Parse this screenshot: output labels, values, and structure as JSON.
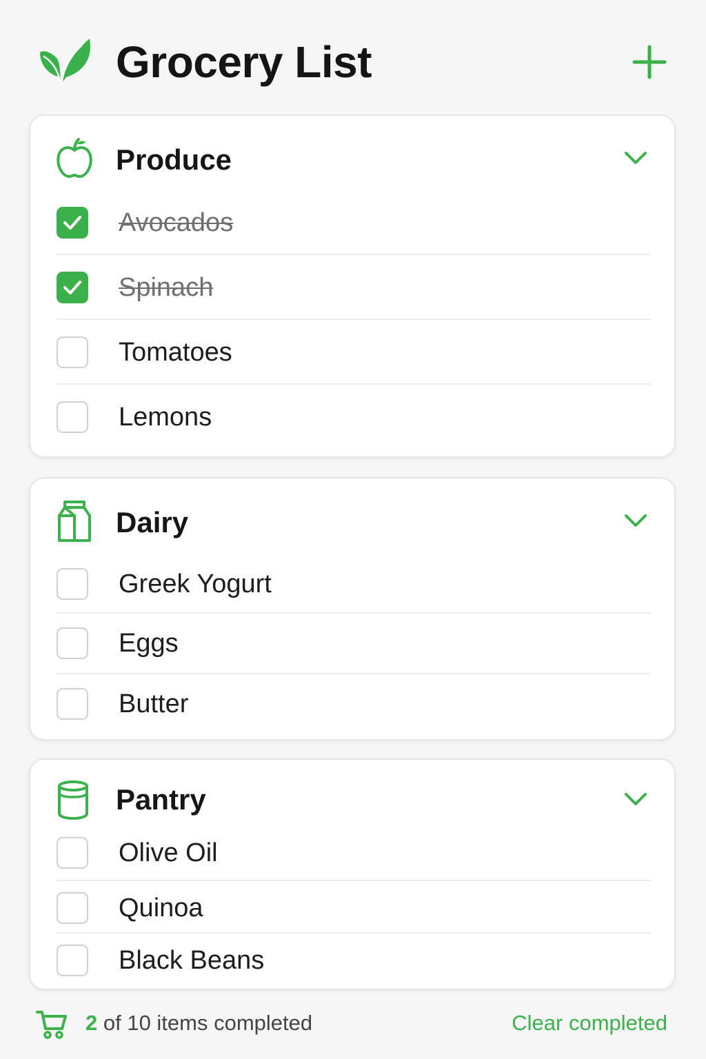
{
  "header": {
    "title": "Grocery List",
    "logo_icon": "leaf-icon",
    "add_icon": "plus-icon"
  },
  "colors": {
    "accent": "#3bb14b",
    "background": "#f6f6f6",
    "card": "#ffffff",
    "checkbox_border": "#cfcfcf",
    "completed_text": "#6f6f6f"
  },
  "sections": [
    {
      "title": "Produce",
      "icon": "apple-icon",
      "expanded": true,
      "items": [
        {
          "label": "Avocados",
          "checked": true
        },
        {
          "label": "Spinach",
          "checked": true
        },
        {
          "label": "Tomatoes",
          "checked": false
        },
        {
          "label": "Lemons",
          "checked": false
        }
      ]
    },
    {
      "title": "Dairy",
      "icon": "milk-carton-icon",
      "expanded": true,
      "items": [
        {
          "label": "Greek Yogurt",
          "checked": false
        },
        {
          "label": "Eggs",
          "checked": false
        },
        {
          "label": "Butter",
          "checked": false
        }
      ]
    },
    {
      "title": "Pantry",
      "icon": "can-icon",
      "expanded": true,
      "items": [
        {
          "label": "Olive Oil",
          "checked": false
        },
        {
          "label": "Quinoa",
          "checked": false
        },
        {
          "label": "Black Beans",
          "checked": false
        }
      ]
    }
  ],
  "footer": {
    "cart_icon": "cart-icon",
    "completed_count": "2",
    "summary_text": " of 10 items completed",
    "clear_label": "Clear completed"
  }
}
